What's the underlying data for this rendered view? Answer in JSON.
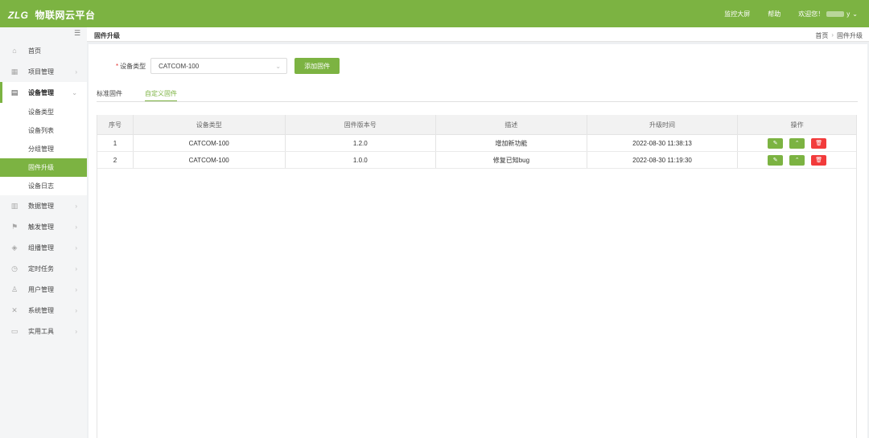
{
  "header": {
    "brand": "ZLG",
    "title": "物联网云平台",
    "nav": [
      "监控大屏",
      "帮助"
    ],
    "welcome": "欢迎您！",
    "user_suffix": "y"
  },
  "sidebar": {
    "items": [
      {
        "label": "首页",
        "icon": "home-icon"
      },
      {
        "label": "项目管理",
        "icon": "project-icon"
      },
      {
        "label": "设备管理",
        "icon": "device-icon"
      },
      {
        "label": "数据管理",
        "icon": "chart-icon"
      },
      {
        "label": "触发管理",
        "icon": "flag-icon"
      },
      {
        "label": "组播管理",
        "icon": "layers-icon"
      },
      {
        "label": "定时任务",
        "icon": "clock-icon"
      },
      {
        "label": "用户管理",
        "icon": "user-icon"
      },
      {
        "label": "系统管理",
        "icon": "tools-icon"
      },
      {
        "label": "实用工具",
        "icon": "toolbox-icon"
      }
    ],
    "sub_items": [
      "设备类型",
      "设备列表",
      "分组管理",
      "固件升级",
      "设备日志"
    ]
  },
  "breadcrumb": {
    "title": "固件升级",
    "path": [
      "首页",
      "固件升级"
    ]
  },
  "form": {
    "label": "设备类型",
    "required_mark": "*",
    "selected": "CATCOM-100",
    "add_button": "添加固件"
  },
  "tabs": [
    "标准固件",
    "自定义固件"
  ],
  "table": {
    "headers": [
      "序号",
      "设备类型",
      "固件版本号",
      "描述",
      "升级时间",
      "操作"
    ],
    "rows": [
      [
        "1",
        "CATCOM-100",
        "1.2.0",
        "增加新功能",
        "2022-08-30 11:38:13"
      ],
      [
        "2",
        "CATCOM-100",
        "1.0.0",
        "修复已知bug",
        "2022-08-30 11:19:30"
      ]
    ]
  },
  "colors": {
    "accent": "#7cb342",
    "danger": "#f23b3b"
  }
}
